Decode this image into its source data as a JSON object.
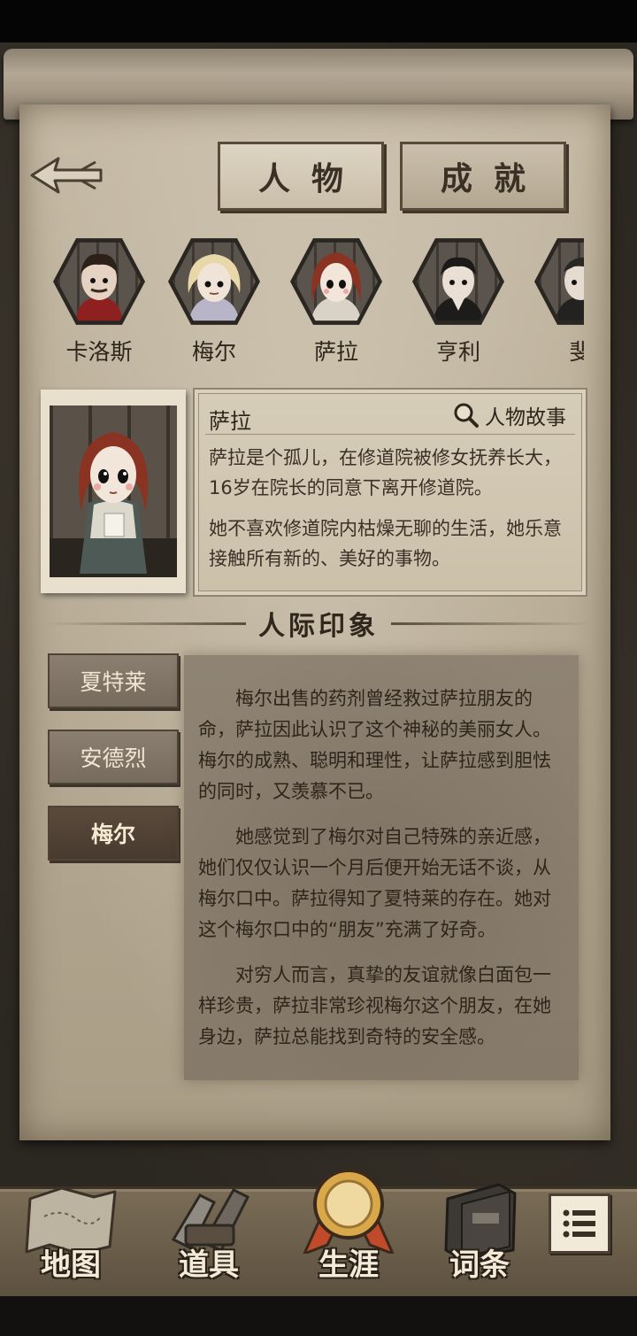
{
  "tabs": [
    {
      "label": "人物",
      "active": true
    },
    {
      "label": "成就",
      "active": false
    }
  ],
  "characters": [
    {
      "name": "卡洛斯",
      "hair": "#2b2118"
    },
    {
      "name": "梅尔",
      "hair": "#e8d7a8"
    },
    {
      "name": "萨拉",
      "hair": "#8a3322",
      "selected": true
    },
    {
      "name": "亨利",
      "hair": "#1c1a19"
    },
    {
      "name": "斐"
    }
  ],
  "profile": {
    "name": "萨拉",
    "story_link": "人物故事",
    "paragraphs": [
      "萨拉是个孤儿，在修道院被修女抚养长大，16岁在院长的同意下离开修道院。",
      "她不喜欢修道院内枯燥无聊的生活，她乐意接触所有新的、美好的事物。"
    ]
  },
  "relations": {
    "title": "人际印象",
    "buttons": [
      {
        "label": "夏特莱",
        "active": false
      },
      {
        "label": "安德烈",
        "active": false
      },
      {
        "label": "梅尔",
        "active": true
      }
    ],
    "paragraphs": [
      "梅尔出售的药剂曾经救过萨拉朋友的命，萨拉因此认识了这个神秘的美丽女人。梅尔的成熟、聪明和理性，让萨拉感到胆怯的同时，又羡慕不已。",
      "她感觉到了梅尔对自己特殊的亲近感，她们仅仅认识一个月后便开始无话不谈，从梅尔口中。萨拉得知了夏特莱的存在。她对这个梅尔口中的“朋友”充满了好奇。",
      "对穷人而言，真挚的友谊就像白面包一样珍贵，萨拉非常珍视梅尔这个朋友，在她身边，萨拉总能找到奇特的安全感。"
    ]
  },
  "bottom_nav": [
    {
      "label": "地图",
      "icon": "map-icon"
    },
    {
      "label": "道具",
      "icon": "tools-icon"
    },
    {
      "label": "生涯",
      "icon": "medal-icon",
      "active": true
    },
    {
      "label": "词条",
      "icon": "book-icon"
    }
  ],
  "menu_icon": "list-menu-icon"
}
